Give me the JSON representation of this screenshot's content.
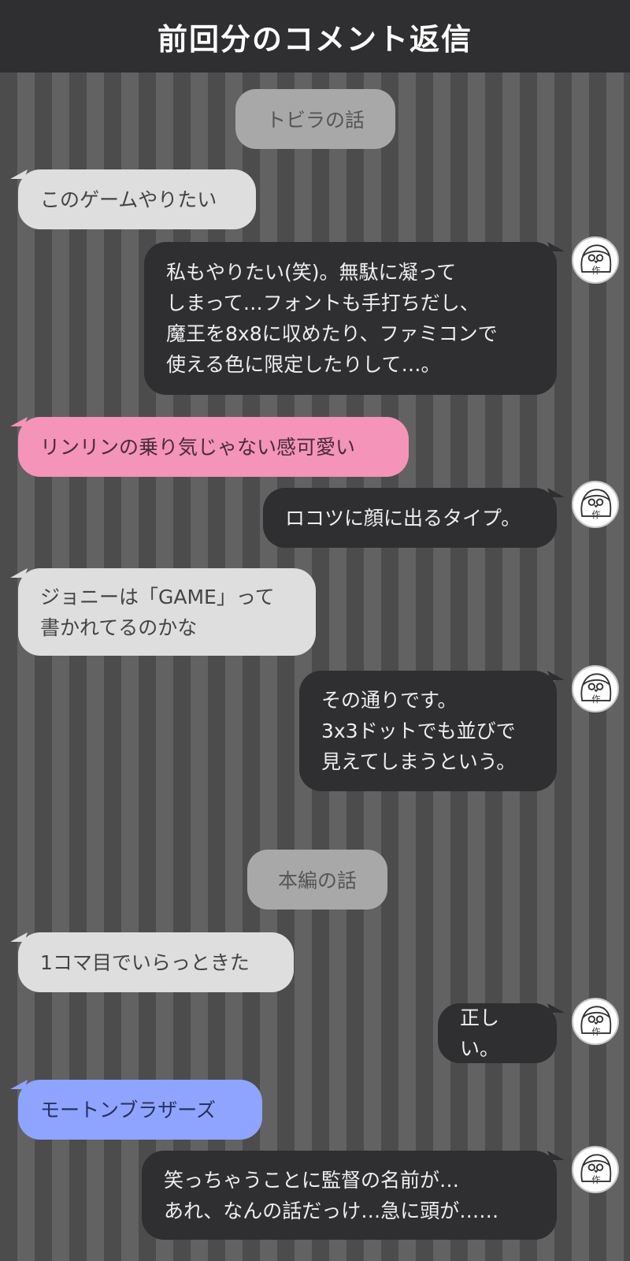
{
  "header": {
    "title": "前回分のコメント返信"
  },
  "sections": {
    "tobira": "トビラの話",
    "honpen": "本編の話"
  },
  "messages": [
    "このゲームやりたい",
    "私もやりたい(笑)。無駄に凝って\nしまって…フォントも手打ちだし、\n魔王を8x8に収めたり、ファミコンで\n使える色に限定したりして…。",
    "リンリンの乗り気じゃない感可愛い",
    "ロコツに顔に出るタイプ。",
    "ジョニーは「GAME」って\n書かれてるのかな",
    "その通りです。\n3x3ドットでも並びで\n見えてしまうという。",
    "1コマ目でいらっときた",
    "正しい。",
    "モートンブラザーズ",
    "笑っちゃうことに監督の名前が…\nあれ、なんの話だっけ…急に頭が……"
  ],
  "avatar": {
    "label": "作",
    "icon": "author-avatar-icon"
  },
  "colors": {
    "header_bg": "#2f2f31",
    "left_bubble": "#dedede",
    "right_bubble": "#2f2f32",
    "pink_bubble": "#f394b8",
    "blue_bubble": "#8ea4ff",
    "section_pill": "#a8a8a8"
  }
}
